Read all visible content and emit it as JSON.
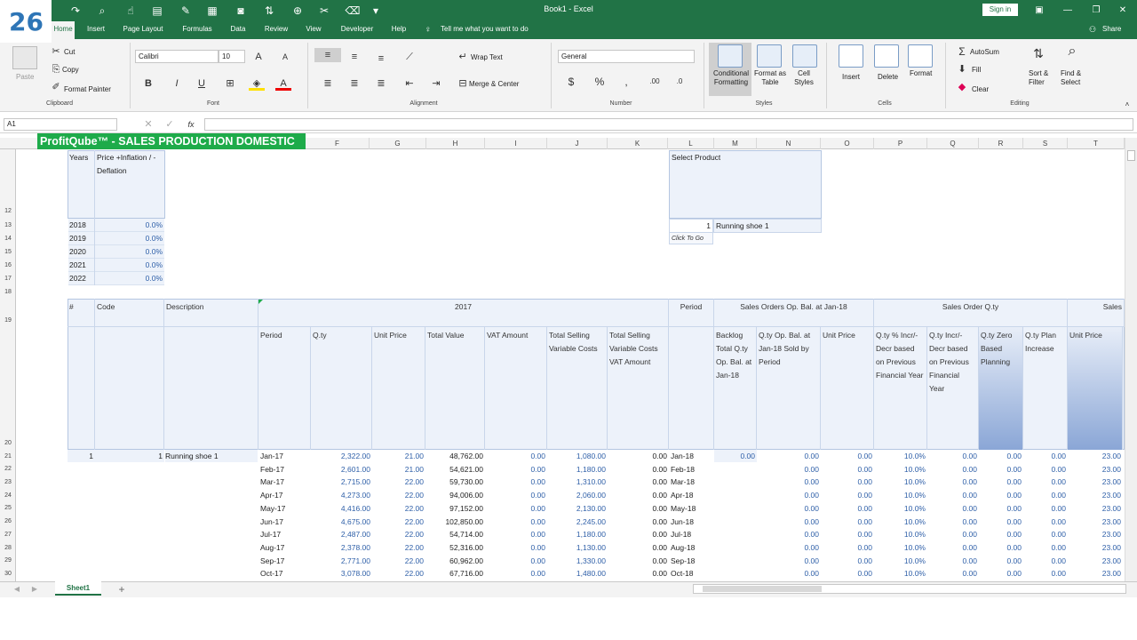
{
  "badge": "26",
  "window": {
    "title": "Book1 - Excel",
    "signin": "Sign in",
    "share": "Share",
    "tellme": "Tell me what you want to do"
  },
  "tabs": [
    "Home",
    "Insert",
    "Page Layout",
    "Formulas",
    "Data",
    "Review",
    "View",
    "Developer",
    "Help"
  ],
  "ribbon": {
    "clipboard": {
      "paste": "Paste",
      "cut": "Cut",
      "copy": "Copy",
      "format_painter": "Format Painter",
      "label": "Clipboard"
    },
    "font": {
      "name": "Calibri",
      "size": "10",
      "bold": "B",
      "italic": "I",
      "underline": "U",
      "label": "Font"
    },
    "alignment": {
      "wrap": "Wrap Text",
      "merge": "Merge & Center",
      "label": "Alignment"
    },
    "number": {
      "format": "General",
      "currency": "$",
      "percent": "%",
      "comma": ",",
      "label": "Number"
    },
    "styles": {
      "cond": "Conditional Formatting",
      "table": "Format as Table",
      "cell": "Cell Styles",
      "label": "Styles"
    },
    "cells": {
      "insert": "Insert",
      "delete": "Delete",
      "format": "Format",
      "label": "Cells"
    },
    "editing": {
      "autosum": "AutoSum",
      "fill": "Fill",
      "clear": "Clear",
      "sort": "Sort & Filter",
      "find": "Find & Select",
      "label": "Editing"
    }
  },
  "formula": {
    "namebox": "A1",
    "fx": "fx"
  },
  "banner": "ProfitQube™ - SALES PRODUCTION DOMESTIC",
  "columns": [
    "F",
    "G",
    "H",
    "I",
    "J",
    "K",
    "L",
    "M",
    "N",
    "O",
    "P",
    "Q",
    "R",
    "S",
    "T"
  ],
  "rows": [
    "12",
    "13",
    "14",
    "15",
    "16",
    "17",
    "18",
    "19",
    "20",
    "21",
    "22",
    "23",
    "24",
    "25",
    "26",
    "27",
    "28",
    "29",
    "30"
  ],
  "inflation": {
    "h1": "Years",
    "h2": "Price +Inflation / -Deflation",
    "rows": [
      [
        "2018",
        "0.0%"
      ],
      [
        "2019",
        "0.0%"
      ],
      [
        "2020",
        "0.0%"
      ],
      [
        "2021",
        "0.0%"
      ],
      [
        "2022",
        "0.0%"
      ]
    ]
  },
  "select": {
    "title": "Select Product",
    "num": "1",
    "product": "Running shoe 1",
    "link": "Click To Go"
  },
  "table": {
    "hash": "#",
    "code": "Code",
    "desc": "Description",
    "year": "2017",
    "period": "Period",
    "opbal": "Sales Orders Op. Bal. at Jan-18",
    "soqty": "Sales Order Q.ty",
    "sales": "Sales",
    "sub": [
      "Period",
      "Q.ty",
      "Unit Price",
      "Total Value",
      "VAT Amount",
      "Total Selling Variable Costs",
      "Total Selling Variable Costs VAT Amount"
    ],
    "sub2": [
      "Backlog Total Q.ty Op. Bal. at Jan-18",
      "Q.ty Op. Bal. at Jan-18 Sold by Period",
      "Unit Price",
      "Q.ty % Incr/-Decr based on Previous Financial Year",
      "Q.ty Incr/-Decr based on Previous Financial Year",
      "Q.ty Zero Based Planning",
      "Q.ty Plan Increase",
      "Unit Price"
    ],
    "item": {
      "num": "1",
      "code": "1",
      "desc": "Running shoe 1",
      "backlog": "0.00"
    },
    "data": [
      [
        "Jan-17",
        "2,322.00",
        "21.00",
        "48,762.00",
        "0.00",
        "1,080.00",
        "0.00",
        "Jan-18",
        "0.00",
        "0.00",
        "10.0%",
        "0.00",
        "0.00",
        "0.00",
        "23.00"
      ],
      [
        "Feb-17",
        "2,601.00",
        "21.00",
        "54,621.00",
        "0.00",
        "1,180.00",
        "0.00",
        "Feb-18",
        "0.00",
        "0.00",
        "10.0%",
        "0.00",
        "0.00",
        "0.00",
        "23.00"
      ],
      [
        "Mar-17",
        "2,715.00",
        "22.00",
        "59,730.00",
        "0.00",
        "1,310.00",
        "0.00",
        "Mar-18",
        "0.00",
        "0.00",
        "10.0%",
        "0.00",
        "0.00",
        "0.00",
        "23.00"
      ],
      [
        "Apr-17",
        "4,273.00",
        "22.00",
        "94,006.00",
        "0.00",
        "2,060.00",
        "0.00",
        "Apr-18",
        "0.00",
        "0.00",
        "10.0%",
        "0.00",
        "0.00",
        "0.00",
        "23.00"
      ],
      [
        "May-17",
        "4,416.00",
        "22.00",
        "97,152.00",
        "0.00",
        "2,130.00",
        "0.00",
        "May-18",
        "0.00",
        "0.00",
        "10.0%",
        "0.00",
        "0.00",
        "0.00",
        "23.00"
      ],
      [
        "Jun-17",
        "4,675.00",
        "22.00",
        "102,850.00",
        "0.00",
        "2,245.00",
        "0.00",
        "Jun-18",
        "0.00",
        "0.00",
        "10.0%",
        "0.00",
        "0.00",
        "0.00",
        "23.00"
      ],
      [
        "Jul-17",
        "2,487.00",
        "22.00",
        "54,714.00",
        "0.00",
        "1,180.00",
        "0.00",
        "Jul-18",
        "0.00",
        "0.00",
        "10.0%",
        "0.00",
        "0.00",
        "0.00",
        "23.00"
      ],
      [
        "Aug-17",
        "2,378.00",
        "22.00",
        "52,316.00",
        "0.00",
        "1,130.00",
        "0.00",
        "Aug-18",
        "0.00",
        "0.00",
        "10.0%",
        "0.00",
        "0.00",
        "0.00",
        "23.00"
      ],
      [
        "Sep-17",
        "2,771.00",
        "22.00",
        "60,962.00",
        "0.00",
        "1,330.00",
        "0.00",
        "Sep-18",
        "0.00",
        "0.00",
        "10.0%",
        "0.00",
        "0.00",
        "0.00",
        "23.00"
      ],
      [
        "Oct-17",
        "3,078.00",
        "22.00",
        "67,716.00",
        "0.00",
        "1,480.00",
        "0.00",
        "Oct-18",
        "0.00",
        "0.00",
        "10.0%",
        "0.00",
        "0.00",
        "0.00",
        "23.00"
      ]
    ]
  },
  "sheet_tab": "Sheet1",
  "add_sheet": "+"
}
